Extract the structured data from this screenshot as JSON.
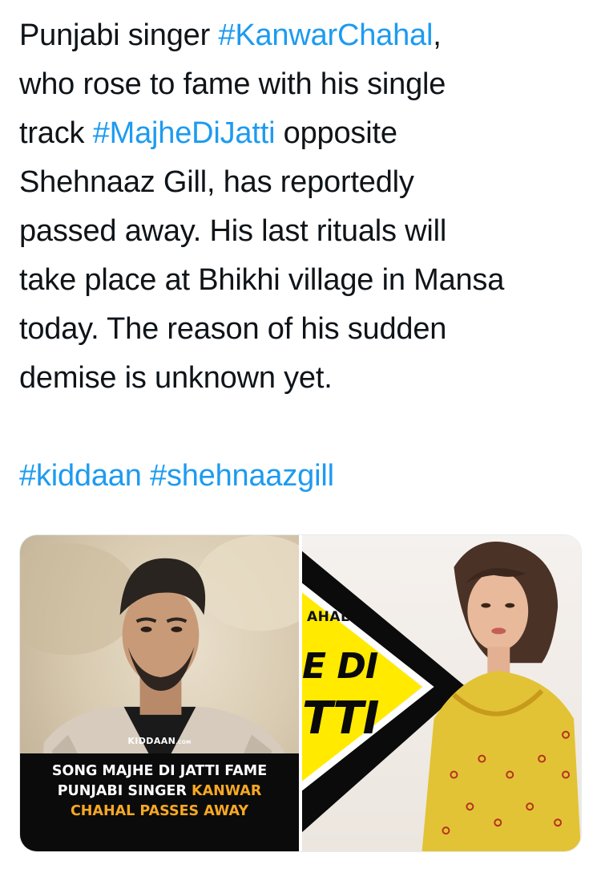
{
  "tweet": {
    "text_lines": [
      [
        {
          "t": "Punjabi singer "
        },
        {
          "t": "#KanwarChahal",
          "tag": true
        },
        {
          "t": ","
        }
      ],
      [
        {
          "t": "who rose to fame with his single"
        }
      ],
      [
        {
          "t": "track "
        },
        {
          "t": "#MajheDiJatti",
          "tag": true
        },
        {
          "t": " opposite"
        }
      ],
      [
        {
          "t": "Shehnaaz Gill, has reportedly"
        }
      ],
      [
        {
          "t": "passed away. His last rituals will"
        }
      ],
      [
        {
          "t": "take place at Bhikhi village in Mansa"
        }
      ],
      [
        {
          "t": "today. The reason of his sudden"
        }
      ],
      [
        {
          "t": "demise is unknown yet."
        }
      ]
    ],
    "hashtags_line": [
      "#kiddaan",
      "#shehnaazgill"
    ]
  },
  "media": {
    "left": {
      "brand": "KIDDAAN",
      "brand_suffix": ".COM",
      "caption_line1": "SONG MAJHE DI JATTI FAME",
      "caption_line2_white": "PUNJABI SINGER ",
      "caption_line2_highlight": "KANWAR",
      "caption_line3_highlight": "CHAHAL PASSES AWAY"
    },
    "right": {
      "poster_small": "AHAL",
      "poster_big_1": "E DI",
      "poster_big_2": "TTI"
    }
  },
  "colors": {
    "text": "#0f1419",
    "hashtag": "#1d9bf0",
    "caption_highlight": "#f7a823",
    "poster_yellow": "#ffea00"
  }
}
